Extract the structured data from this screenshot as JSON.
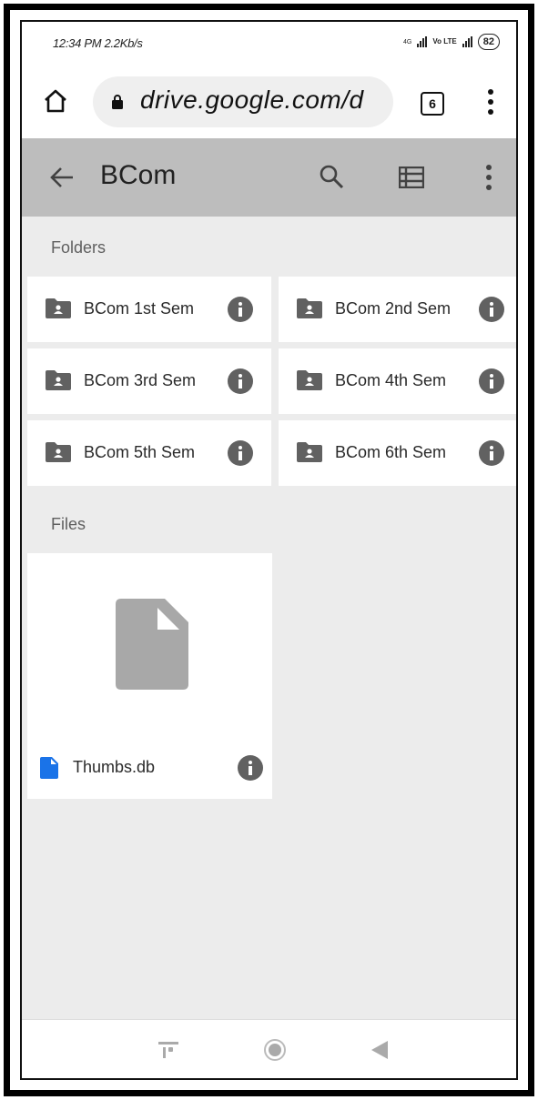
{
  "status_bar": {
    "time": "12:34 PM",
    "speed": "2.2Kb/s",
    "network": "4G",
    "volte": "Vo LTE",
    "battery": "82"
  },
  "browser": {
    "url": "drive.google.com/d",
    "tab_count": "6"
  },
  "app_bar": {
    "title": "BCom"
  },
  "sections": {
    "folders_label": "Folders",
    "files_label": "Files"
  },
  "folders": [
    {
      "name": "BCom 1st Sem"
    },
    {
      "name": "BCom 2nd Sem"
    },
    {
      "name": "BCom 3rd Sem"
    },
    {
      "name": "BCom 4th Sem"
    },
    {
      "name": "BCom 5th Sem"
    },
    {
      "name": "BCom 6th Sem"
    }
  ],
  "files": [
    {
      "name": "Thumbs.db"
    }
  ],
  "icons": {
    "home": "home-icon",
    "lock": "lock-icon",
    "back": "arrow-back-icon",
    "search": "search-icon",
    "view": "list-view-icon",
    "more": "more-vert-icon",
    "folder": "shared-folder-icon",
    "info": "info-icon",
    "file": "file-icon"
  },
  "colors": {
    "app_bar": "#bdbdbd",
    "background": "#ececec",
    "icon_gray": "#616161",
    "file_blue": "#1a73e8"
  }
}
